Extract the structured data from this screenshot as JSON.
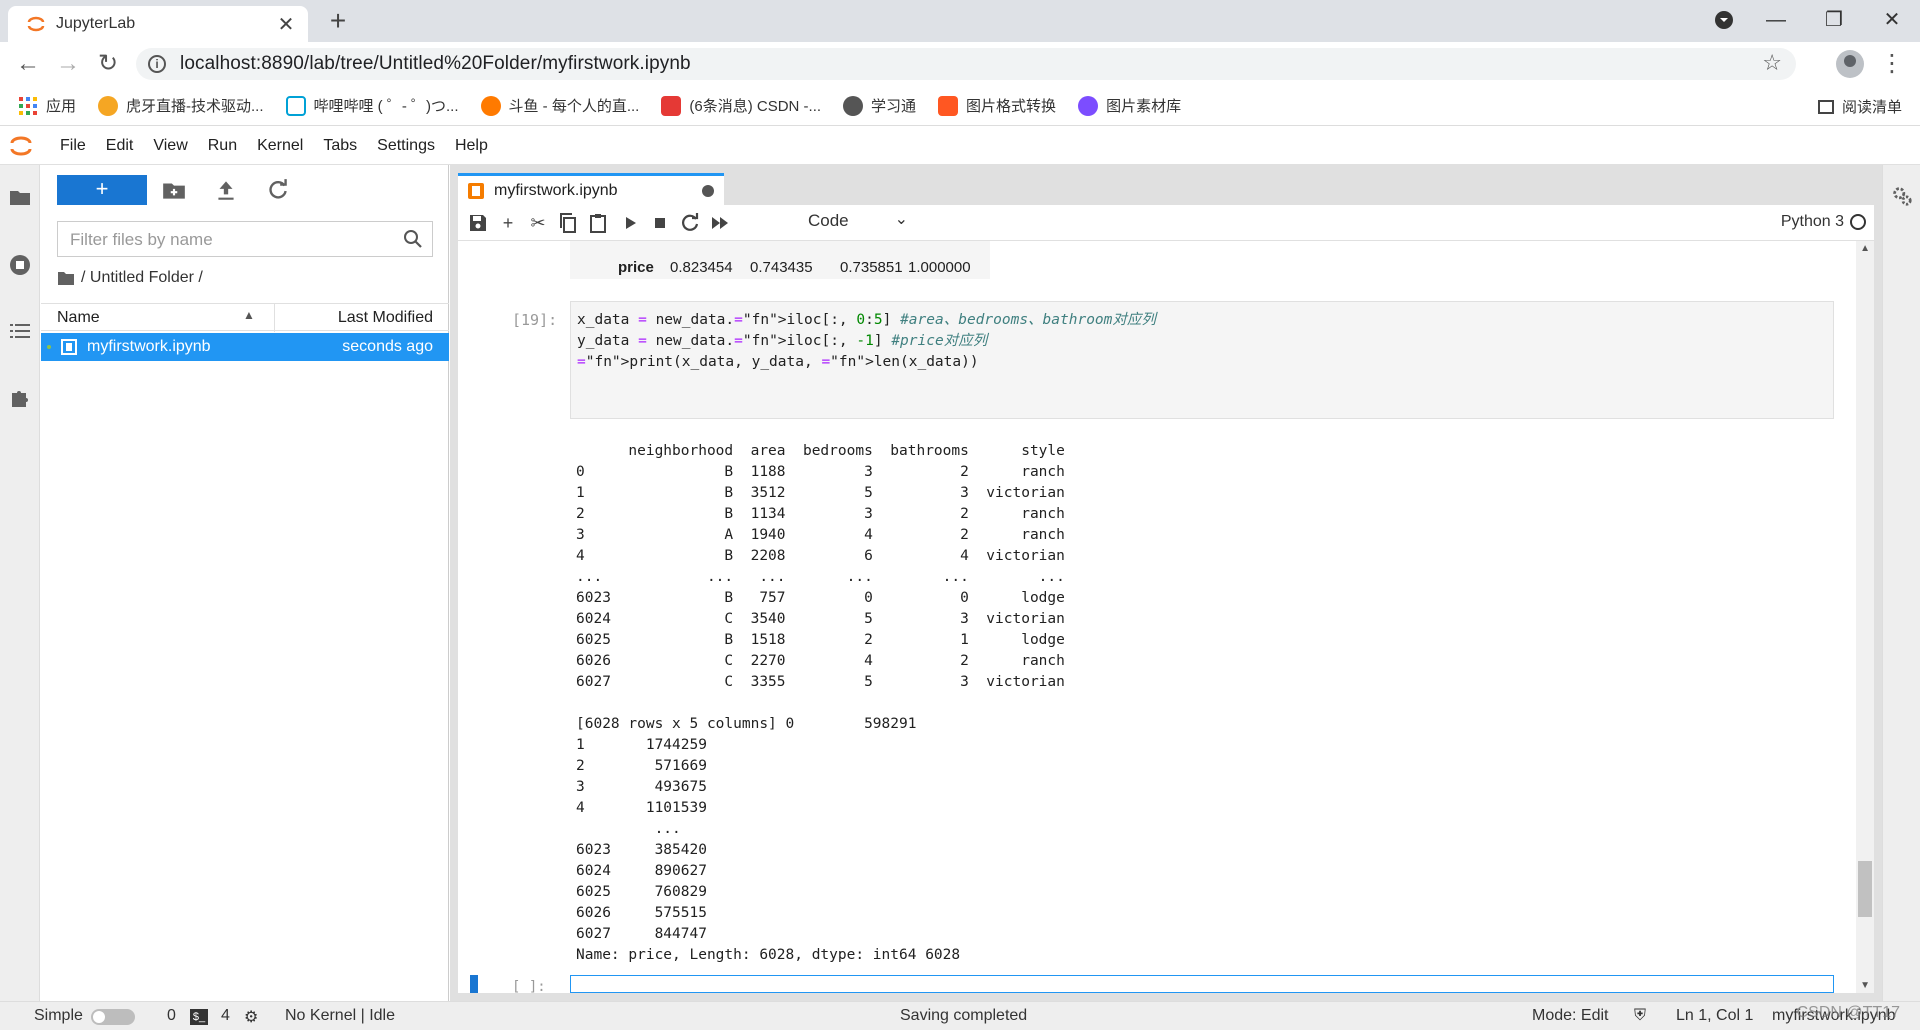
{
  "browser": {
    "tab_title": "JupyterLab",
    "tab_close": "✕",
    "new_tab": "+",
    "url": "localhost:8890/lab/tree/Untitled%20Folder/myfirstwork.ipynb",
    "bookmarks": [
      {
        "label": "应用",
        "color": "#ea4335"
      },
      {
        "label": "虎牙直播-技术驱动...",
        "color": "#f5a623"
      },
      {
        "label": "哔哩哔哩 ( ゜- ゜)つ...",
        "color": "#00a1d6"
      },
      {
        "label": "斗鱼 - 每个人的直...",
        "color": "#ff7a00"
      },
      {
        "label": "(6条消息) CSDN -...",
        "color": "#e53935"
      },
      {
        "label": "学习通",
        "color": "#555555"
      },
      {
        "label": "图片格式转换",
        "color": "#ff5722"
      },
      {
        "label": "图片素材库",
        "color": "#7c4dff"
      }
    ],
    "reading_list": "阅读清单"
  },
  "menubar": [
    "File",
    "Edit",
    "View",
    "Run",
    "Kernel",
    "Tabs",
    "Settings",
    "Help"
  ],
  "filebrowser": {
    "new_label": "+",
    "filter_placeholder": "Filter files by name",
    "breadcrumb": "/ Untitled Folder /",
    "col_name": "Name",
    "col_modified": "Last Modified",
    "file": {
      "name": "myfirstwork.ipynb",
      "modified": "seconds ago"
    }
  },
  "notebook": {
    "tab_title": "myfirstwork.ipynb",
    "cell_type": "Code",
    "kernel": "Python 3",
    "prev_output": {
      "row_label": "price",
      "values": [
        "0.823454",
        "0.743435",
        "0.735851",
        "1.000000"
      ]
    },
    "cell19": {
      "prompt": "[19]:",
      "code": [
        "x_data = new_data.iloc[:, 0:5] #area、bedrooms、bathroom对应列",
        "y_data = new_data.iloc[:, -1] #price对应列",
        "print(x_data, y_data, len(x_data))"
      ],
      "output": "      neighborhood  area  bedrooms  bathrooms      style\n0                B  1188         3          2      ranch\n1                B  3512         5          3  victorian\n2                B  1134         3          2      ranch\n3                A  1940         4          2      ranch\n4                B  2208         6          4  victorian\n...            ...   ...       ...        ...        ...\n6023             B   757         0          0      lodge\n6024             C  3540         5          3  victorian\n6025             B  1518         2          1      lodge\n6026             C  2270         4          2      ranch\n6027             C  3355         5          3  victorian\n\n[6028 rows x 5 columns] 0        598291\n1       1744259\n2        571669\n3        493675\n4       1101539\n         ...   \n6023     385420\n6024     890627\n6025     760829\n6026     575515\n6027     844747\nName: price, Length: 6028, dtype: int64 6028"
    },
    "new_cell_prompt": "[ ]:"
  },
  "statusbar": {
    "mode_label": "Simple",
    "terminals": "0",
    "kernels": "4",
    "kernel_status": "No Kernel | Idle",
    "saving": "Saving completed",
    "mode": "Mode: Edit",
    "cursor": "Ln 1, Col 1",
    "filename": "myfirstwork.ipynb"
  },
  "watermark": "CSDN @TT17"
}
